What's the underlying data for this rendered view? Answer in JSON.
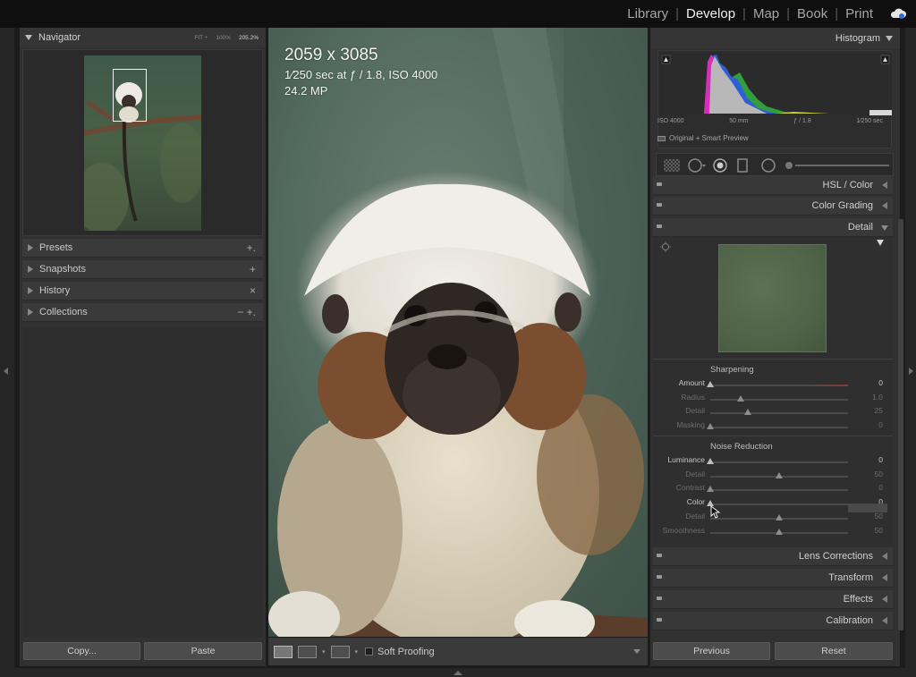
{
  "top_nav": {
    "modules": [
      "Library",
      "Develop",
      "Map",
      "Book",
      "Print"
    ],
    "active": "Develop"
  },
  "left_panel": {
    "navigator": {
      "title": "Navigator",
      "zoom_options": [
        "FIT ÷",
        "100%",
        "205.2%"
      ],
      "selected_zoom": "205.2%"
    },
    "sections": [
      {
        "label": "Presets",
        "action": "+."
      },
      {
        "label": "Snapshots",
        "action": "+"
      },
      {
        "label": "History",
        "action": "×"
      },
      {
        "label": "Collections",
        "action": "− +."
      }
    ],
    "copy_button": "Copy...",
    "paste_button": "Paste"
  },
  "photo_info": {
    "dimensions": "2059 x 3085",
    "exposure": "1⁄250 sec at ƒ / 1.8, ISO 4000",
    "megapixels": "24.2 MP"
  },
  "bottom_toolbar": {
    "soft_proofing_label": "Soft Proofing",
    "soft_proofing_checked": false
  },
  "right_panel": {
    "histogram": {
      "title": "Histogram",
      "iso": "ISO 4000",
      "focal": "50 mm",
      "aperture": "ƒ / 1.8",
      "shutter": "1⁄250 sec",
      "preview": "Original + Smart Preview"
    },
    "sections": {
      "hsl": "HSL / Color",
      "color_grading": "Color Grading",
      "detail": "Detail",
      "lens": "Lens Corrections",
      "transform": "Transform",
      "effects": "Effects",
      "calibration": "Calibration"
    },
    "sharpening": {
      "title": "Sharpening",
      "sliders": [
        {
          "label": "Amount",
          "value": "0",
          "pos": 0.0,
          "active": true
        },
        {
          "label": "Radius",
          "value": "1.0",
          "pos": 0.22,
          "active": false
        },
        {
          "label": "Detail",
          "value": "25",
          "pos": 0.27,
          "active": false
        },
        {
          "label": "Masking",
          "value": "0",
          "pos": 0.0,
          "active": false
        }
      ]
    },
    "noise_reduction": {
      "title": "Noise Reduction",
      "sliders": [
        {
          "label": "Luminance",
          "value": "0",
          "pos": 0.0,
          "active": true
        },
        {
          "label": "Detail",
          "value": "50",
          "pos": 0.5,
          "active": false
        },
        {
          "label": "Contrast",
          "value": "0",
          "pos": 0.0,
          "active": false
        },
        {
          "label": "Color",
          "value": "0",
          "pos": 0.0,
          "active": true
        },
        {
          "label": "Detail",
          "value": "50",
          "pos": 0.5,
          "active": false
        },
        {
          "label": "Smoothness",
          "value": "50",
          "pos": 0.5,
          "active": false
        }
      ]
    },
    "previous_button": "Previous",
    "reset_button": "Reset"
  }
}
